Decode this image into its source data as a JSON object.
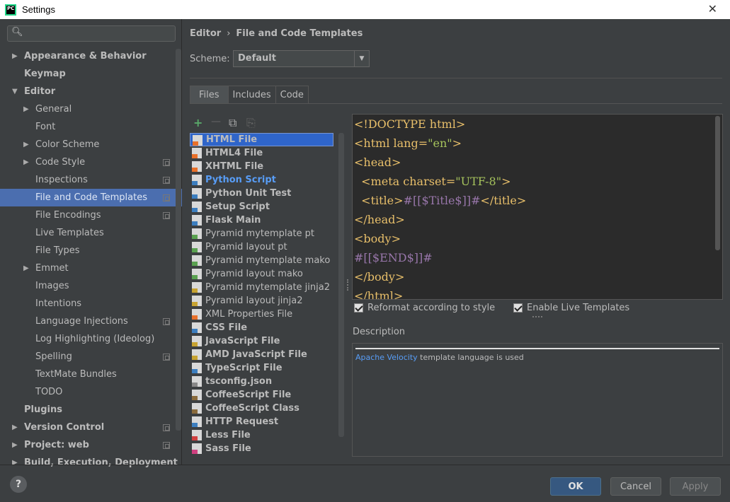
{
  "window": {
    "title": "Settings",
    "app_icon_text": "PC"
  },
  "search": {
    "placeholder": ""
  },
  "tree": [
    {
      "label": "Appearance & Behavior",
      "arrow": "▶"
    },
    {
      "label": "Keymap",
      "arrow": ""
    },
    {
      "label": "Editor",
      "arrow": "▼"
    },
    {
      "label": "General",
      "arrow": "▶"
    },
    {
      "label": "Font",
      "arrow": ""
    },
    {
      "label": "Color Scheme",
      "arrow": "▶"
    },
    {
      "label": "Code Style",
      "arrow": "▶"
    },
    {
      "label": "Inspections",
      "arrow": ""
    },
    {
      "label": "File and Code Templates",
      "arrow": ""
    },
    {
      "label": "File Encodings",
      "arrow": ""
    },
    {
      "label": "Live Templates",
      "arrow": ""
    },
    {
      "label": "File Types",
      "arrow": ""
    },
    {
      "label": "Emmet",
      "arrow": "▶"
    },
    {
      "label": "Images",
      "arrow": ""
    },
    {
      "label": "Intentions",
      "arrow": ""
    },
    {
      "label": "Language Injections",
      "arrow": ""
    },
    {
      "label": "Log Highlighting (Ideolog)",
      "arrow": ""
    },
    {
      "label": "Spelling",
      "arrow": ""
    },
    {
      "label": "TextMate Bundles",
      "arrow": ""
    },
    {
      "label": "TODO",
      "arrow": ""
    },
    {
      "label": "Plugins",
      "arrow": ""
    },
    {
      "label": "Version Control",
      "arrow": "▶"
    },
    {
      "label": "Project: web",
      "arrow": "▶"
    },
    {
      "label": "Build, Execution, Deployment",
      "arrow": "▶"
    }
  ],
  "breadcrumb": {
    "parent": "Editor",
    "separator": "›",
    "current": "File and Code Templates"
  },
  "scheme": {
    "label": "Scheme:",
    "value": "Default",
    "dropdown": "▼"
  },
  "tabs": [
    "Files",
    "Includes",
    "Code"
  ],
  "toolbar": {
    "add": "+",
    "remove": "—",
    "copy": "⧉",
    "reset": "⎘"
  },
  "templates": [
    {
      "name": "HTML File",
      "color": "#e8702a"
    },
    {
      "name": "HTML4 File",
      "color": "#e8702a"
    },
    {
      "name": "XHTML File",
      "color": "#e8702a"
    },
    {
      "name": "Python Script",
      "color": "#3c7ebf"
    },
    {
      "name": "Python Unit Test",
      "color": "#3c7ebf"
    },
    {
      "name": "Setup Script",
      "color": "#3c7ebf"
    },
    {
      "name": "Flask Main",
      "color": "#3c7ebf"
    },
    {
      "name": "Pyramid mytemplate pt",
      "color": "#5aa150"
    },
    {
      "name": "Pyramid layout pt",
      "color": "#5aa150"
    },
    {
      "name": "Pyramid mytemplate mako",
      "color": "#5aa150"
    },
    {
      "name": "Pyramid layout mako",
      "color": "#5aa150"
    },
    {
      "name": "Pyramid mytemplate jinja2",
      "color": "#c7a331"
    },
    {
      "name": "Pyramid layout jinja2",
      "color": "#c7a331"
    },
    {
      "name": "XML Properties File",
      "color": "#e8702a"
    },
    {
      "name": "CSS File",
      "color": "#3c7ebf"
    },
    {
      "name": "JavaScript File",
      "color": "#c7a331"
    },
    {
      "name": "AMD JavaScript File",
      "color": "#c7a331"
    },
    {
      "name": "TypeScript File",
      "color": "#3c7ebf"
    },
    {
      "name": "tsconfig.json",
      "color": "#888888"
    },
    {
      "name": "CoffeeScript File",
      "color": "#8a6b3c"
    },
    {
      "name": "CoffeeScript Class",
      "color": "#8a6b3c"
    },
    {
      "name": "HTTP Request",
      "color": "#3c7ebf"
    },
    {
      "name": "Less File",
      "color": "#d04040"
    },
    {
      "name": "Sass File",
      "color": "#d04080"
    }
  ],
  "editor": {
    "lines": [
      "<!DOCTYPE html>",
      "<html lang=\"en\">",
      "<head>",
      "  <meta charset=\"UTF-8\">",
      "  <title>#[[$Title$]]#</title>",
      "</head>",
      "<body>",
      "#[[$END$]]#",
      "</body>",
      "</html>"
    ]
  },
  "options": {
    "reformat": "Reformat according to style",
    "live_templates": "Enable Live Templates"
  },
  "description": {
    "label": "Description",
    "link": "Apache Velocity",
    "text": " template language is used"
  },
  "buttons": {
    "ok": "OK",
    "cancel": "Cancel",
    "apply": "Apply",
    "help": "?"
  },
  "colors": {
    "selection": "#4b6eaf",
    "list_selection": "#2f65ca",
    "link": "#589df6"
  }
}
